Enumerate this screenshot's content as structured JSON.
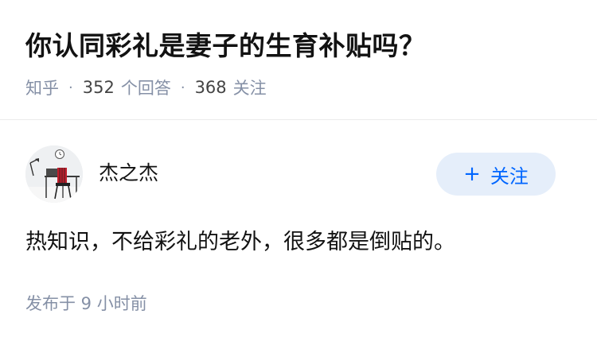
{
  "question": {
    "title": "你认同彩礼是妻子的生育补贴吗？",
    "source": "知乎",
    "answer_count": "352",
    "answer_label": "个回答",
    "follower_count": "368",
    "follower_label": "关注",
    "separator": "·"
  },
  "answer": {
    "author_name": "杰之杰",
    "avatar_icon": "avatar-desk-chair-photo",
    "follow_button": {
      "plus": "+",
      "label": "关注"
    },
    "content": "热知识，不给彩礼的老外，很多都是倒贴的。",
    "publish_time": "发布于 9 小时前"
  },
  "colors": {
    "text": "#121212",
    "meta": "#8590a6",
    "accent": "#0066ff",
    "follow_bg": "#e5eefa",
    "divider": "#ebebeb"
  }
}
